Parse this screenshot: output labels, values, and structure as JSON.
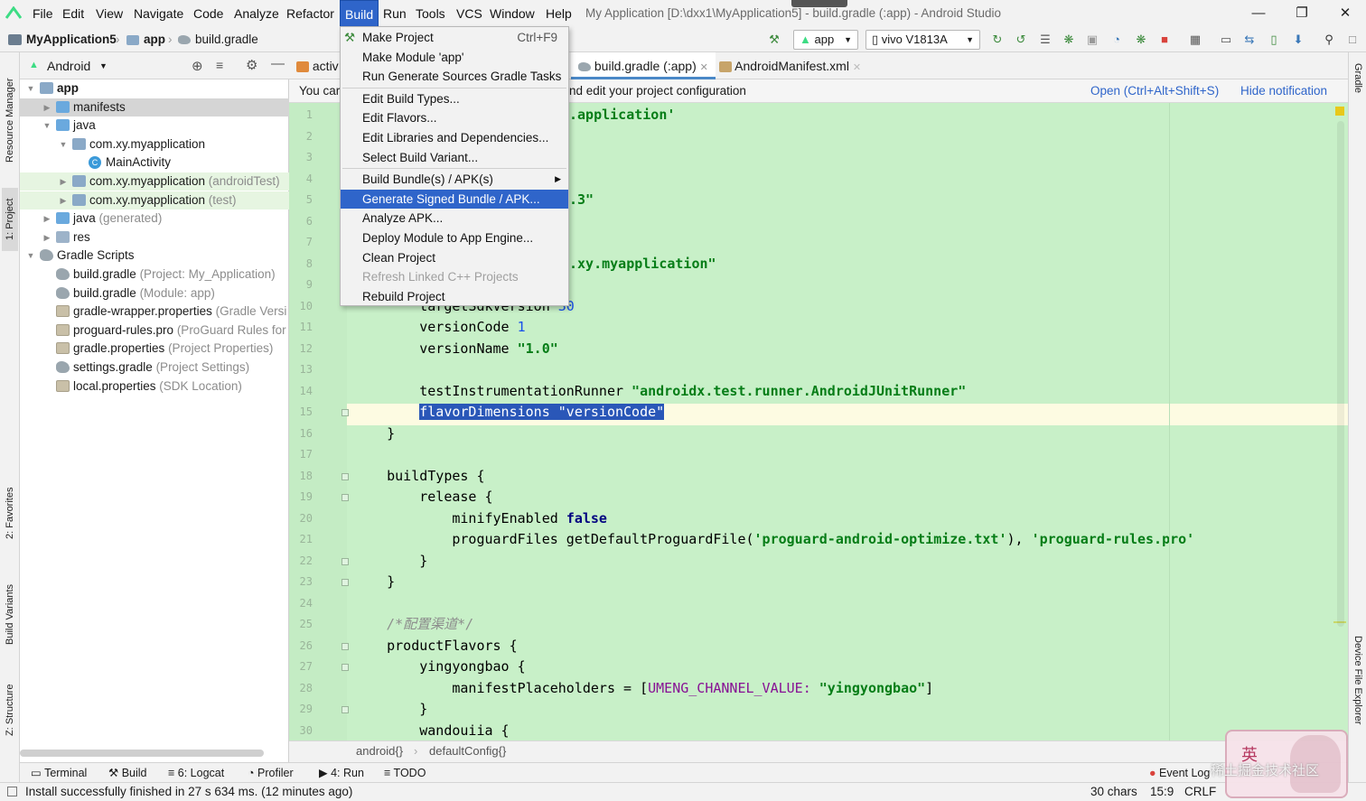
{
  "menubar": {
    "items": [
      "File",
      "Edit",
      "View",
      "Navigate",
      "Code",
      "Analyze",
      "Refactor",
      "Build",
      "Run",
      "Tools",
      "VCS",
      "Window",
      "Help"
    ],
    "active": "Build",
    "window_title": "My Application [D:\\dxx1\\MyApplication5] - build.gradle (:app) - Android Studio"
  },
  "navbar": {
    "crumbs": [
      "MyApplication5",
      "app",
      "build.gradle"
    ],
    "run_config": "app",
    "device": "vivo V1813A"
  },
  "project_panel": {
    "view": "Android",
    "tree": [
      {
        "label": "app",
        "hint": "",
        "level": 0,
        "icon": "folder",
        "expanded": true,
        "bold": true
      },
      {
        "label": "manifests",
        "hint": "",
        "level": 1,
        "icon": "folder-blue",
        "expanded": false,
        "selected": true
      },
      {
        "label": "java",
        "hint": "",
        "level": 1,
        "icon": "folder-blue",
        "expanded": true
      },
      {
        "label": "com.xy.myapplication",
        "hint": "",
        "level": 2,
        "icon": "folder",
        "expanded": true
      },
      {
        "label": "MainActivity",
        "hint": "",
        "level": 3,
        "icon": "class"
      },
      {
        "label": "com.xy.myapplication",
        "hint": "(androidTest)",
        "level": 2,
        "icon": "folder",
        "expanded": false,
        "green": true
      },
      {
        "label": "com.xy.myapplication",
        "hint": "(test)",
        "level": 2,
        "icon": "folder",
        "expanded": false,
        "green": true
      },
      {
        "label": "java",
        "hint": "(generated)",
        "level": 1,
        "icon": "folder-blue",
        "expanded": false
      },
      {
        "label": "res",
        "hint": "",
        "level": 1,
        "icon": "folder-res",
        "expanded": false
      },
      {
        "label": "Gradle Scripts",
        "hint": "",
        "level": 0,
        "icon": "gradle",
        "expanded": true
      },
      {
        "label": "build.gradle",
        "hint": "(Project: My_Application)",
        "level": 1,
        "icon": "gradle"
      },
      {
        "label": "build.gradle",
        "hint": "(Module: app)",
        "level": 1,
        "icon": "gradle"
      },
      {
        "label": "gradle-wrapper.properties",
        "hint": "(Gradle Versi",
        "level": 1,
        "icon": "prop"
      },
      {
        "label": "proguard-rules.pro",
        "hint": "(ProGuard Rules for",
        "level": 1,
        "icon": "prop"
      },
      {
        "label": "gradle.properties",
        "hint": "(Project Properties)",
        "level": 1,
        "icon": "prop"
      },
      {
        "label": "settings.gradle",
        "hint": "(Project Settings)",
        "level": 1,
        "icon": "gradle"
      },
      {
        "label": "local.properties",
        "hint": "(SDK Location)",
        "level": 1,
        "icon": "prop"
      }
    ]
  },
  "left_strip": [
    "Resource Manager",
    "1: Project",
    "2: Favorites",
    "Build Variants",
    "Z: Structure"
  ],
  "right_strip": [
    "Gradle",
    "Device File Explorer"
  ],
  "editor_tabs": [
    {
      "label": "activ",
      "active": false
    },
    {
      "label": "build.gradle (:app)",
      "active": true
    },
    {
      "label": "AndroidManifest.xml",
      "active": false
    }
  ],
  "notification": {
    "left_text": "You car",
    "right_text": "nd edit your project configuration",
    "open_link": "Open (Ctrl+Alt+Shift+S)",
    "hide_link": "Hide notification"
  },
  "code_lines": [
    {
      "n": "1",
      "segs": [
        {
          "t": "",
          "c": ""
        }
      ]
    },
    {
      "n": "2",
      "segs": [
        {
          "t": "",
          "c": ""
        }
      ]
    },
    {
      "n": "3",
      "segs": [
        {
          "t": "",
          "c": ""
        }
      ]
    },
    {
      "n": "4",
      "segs": [
        {
          "t": "",
          "c": ""
        }
      ]
    },
    {
      "n": "5",
      "segs": [
        {
          "t": "",
          "c": ""
        }
      ]
    },
    {
      "n": "6",
      "segs": [
        {
          "t": "",
          "c": ""
        }
      ]
    },
    {
      "n": "7",
      "segs": [
        {
          "t": "",
          "c": ""
        }
      ]
    },
    {
      "n": "8",
      "segs": [
        {
          "t": "",
          "c": ""
        }
      ]
    },
    {
      "n": "9",
      "segs": [
        {
          "t": "",
          "c": ""
        }
      ]
    },
    {
      "n": "10",
      "segs": [
        {
          "t": "        targetSdkVersion ",
          "c": ""
        },
        {
          "t": "30",
          "c": "num"
        }
      ]
    },
    {
      "n": "11",
      "segs": [
        {
          "t": "        versionCode ",
          "c": ""
        },
        {
          "t": "1",
          "c": "num"
        }
      ]
    },
    {
      "n": "12",
      "segs": [
        {
          "t": "        versionName ",
          "c": ""
        },
        {
          "t": "\"1.0\"",
          "c": "str"
        }
      ]
    },
    {
      "n": "13",
      "segs": [
        {
          "t": "",
          "c": ""
        }
      ]
    },
    {
      "n": "14",
      "segs": [
        {
          "t": "        testInstrumentationRunner ",
          "c": ""
        },
        {
          "t": "\"androidx.test.runner.AndroidJUnitRunner\"",
          "c": "str"
        }
      ]
    },
    {
      "n": "15",
      "segs": [
        {
          "t": "        ",
          "c": ""
        },
        {
          "t": "flavorDimensions \"versionCode\"",
          "c": "sel"
        }
      ]
    },
    {
      "n": "16",
      "segs": [
        {
          "t": "    }",
          "c": ""
        }
      ]
    },
    {
      "n": "17",
      "segs": [
        {
          "t": "",
          "c": ""
        }
      ]
    },
    {
      "n": "18",
      "segs": [
        {
          "t": "    buildTypes {",
          "c": ""
        }
      ]
    },
    {
      "n": "19",
      "segs": [
        {
          "t": "        release {",
          "c": ""
        }
      ]
    },
    {
      "n": "20",
      "segs": [
        {
          "t": "            minifyEnabled ",
          "c": ""
        },
        {
          "t": "false",
          "c": "kw"
        }
      ]
    },
    {
      "n": "21",
      "segs": [
        {
          "t": "            proguardFiles getDefaultProguardFile(",
          "c": ""
        },
        {
          "t": "'proguard-android-optimize.txt'",
          "c": "str"
        },
        {
          "t": "), ",
          "c": ""
        },
        {
          "t": "'proguard-rules.pro'",
          "c": "str"
        }
      ]
    },
    {
      "n": "22",
      "segs": [
        {
          "t": "        }",
          "c": ""
        }
      ]
    },
    {
      "n": "23",
      "segs": [
        {
          "t": "    }",
          "c": ""
        }
      ]
    },
    {
      "n": "24",
      "segs": [
        {
          "t": "",
          "c": ""
        }
      ]
    },
    {
      "n": "25",
      "segs": [
        {
          "t": "    /*配置渠道*/",
          "c": "cm"
        }
      ]
    },
    {
      "n": "26",
      "segs": [
        {
          "t": "    productFlavors {",
          "c": ""
        }
      ]
    },
    {
      "n": "27",
      "segs": [
        {
          "t": "        yingyongbao {",
          "c": ""
        }
      ]
    },
    {
      "n": "28",
      "segs": [
        {
          "t": "            manifestPlaceholders = [",
          "c": ""
        },
        {
          "t": "UMENG_CHANNEL_VALUE: ",
          "c": "kwp"
        },
        {
          "t": "\"yingyongbao\"",
          "c": "str"
        },
        {
          "t": "]",
          "c": ""
        }
      ]
    },
    {
      "n": "29",
      "segs": [
        {
          "t": "        }",
          "c": ""
        }
      ]
    },
    {
      "n": "30",
      "segs": [
        {
          "t": "        wandouiia {",
          "c": ""
        }
      ]
    }
  ],
  "code_fragments": [
    {
      "line": 1,
      "text": ".application'"
    },
    {
      "line": 5,
      "text": ".3\""
    },
    {
      "line": 8,
      "text": ".xy.myapplication\""
    }
  ],
  "breadcrumb_bottom": [
    "android{}",
    "defaultConfig{}"
  ],
  "bottom_tools": [
    "Terminal",
    "Build",
    "6: Logcat",
    "Profiler",
    "4: Run",
    "TODO",
    "Event Log"
  ],
  "status": {
    "message": "Install successfully finished in 27 s 634 ms. (12 minutes ago)",
    "chars": "30 chars",
    "position": "15:9",
    "line_sep": "CRLF"
  },
  "build_menu": {
    "items": [
      {
        "label": "Make Project",
        "shortcut": "Ctrl+F9"
      },
      {
        "label": "Make Module 'app'"
      },
      {
        "label": "Run Generate Sources Gradle Tasks"
      },
      {
        "sep": true
      },
      {
        "label": "Edit Build Types..."
      },
      {
        "label": "Edit Flavors..."
      },
      {
        "label": "Edit Libraries and Dependencies..."
      },
      {
        "label": "Select Build Variant..."
      },
      {
        "sep": true
      },
      {
        "label": "Build Bundle(s) / APK(s)",
        "submenu": true
      },
      {
        "label": "Generate Signed Bundle / APK...",
        "highlighted": true
      },
      {
        "label": "Analyze APK..."
      },
      {
        "label": "Deploy Module to App Engine..."
      },
      {
        "label": "Clean Project"
      },
      {
        "label": "Refresh Linked C++ Projects",
        "disabled": true
      },
      {
        "label": "Rebuild Project"
      }
    ]
  },
  "ime_char": "英",
  "watermark": "稀土掘金技术社区",
  "colors": {
    "accent": "#2f65ca",
    "editor_bg": "#c8f0c8",
    "selection": "#2a57b8"
  }
}
